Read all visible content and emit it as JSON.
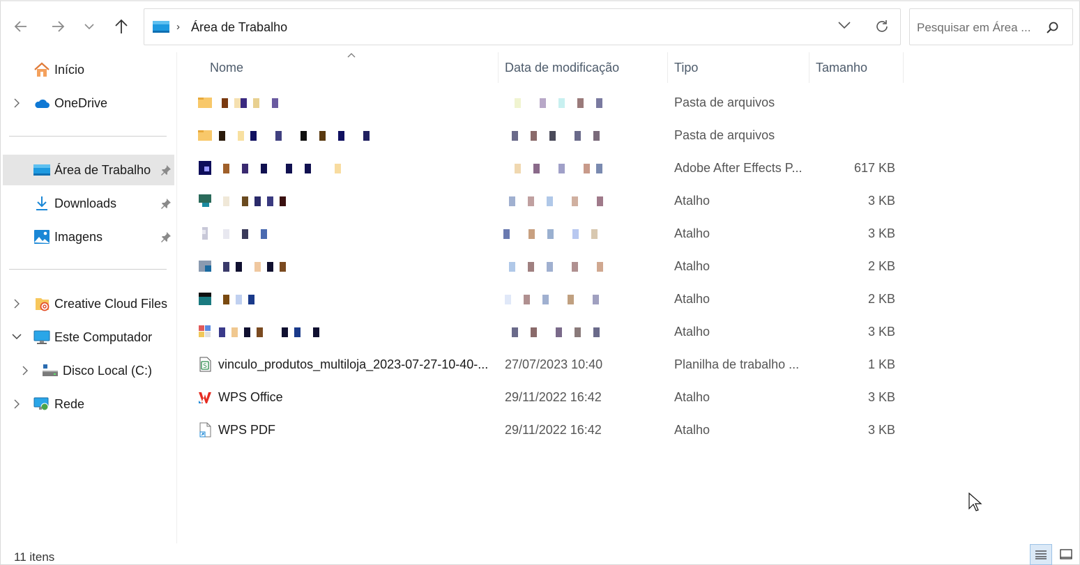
{
  "toolbar": {
    "back": "back-arrow-icon",
    "forward": "forward-arrow-icon",
    "recent": "chevron-down-icon",
    "up": "up-arrow-icon"
  },
  "address": {
    "location": "Área de Trabalho",
    "separator": "›"
  },
  "search": {
    "placeholder": "Pesquisar em Área ..."
  },
  "sidebar": {
    "items": [
      {
        "label": "Início",
        "icon": "home-icon"
      },
      {
        "label": "OneDrive",
        "icon": "cloud-icon"
      },
      {
        "label": "Área de Trabalho",
        "icon": "desktop-icon",
        "selected": true,
        "pinned": true
      },
      {
        "label": "Downloads",
        "icon": "download-icon",
        "pinned": true
      },
      {
        "label": "Imagens",
        "icon": "pictures-icon",
        "pinned": true
      },
      {
        "label": "Creative Cloud Files",
        "icon": "creative-cloud-folder-icon"
      },
      {
        "label": "Este Computador",
        "icon": "computer-icon",
        "expanded": true
      },
      {
        "label": "Disco Local (C:)",
        "icon": "drive-icon"
      },
      {
        "label": "Rede",
        "icon": "network-icon"
      }
    ]
  },
  "columns": {
    "name": "Nome",
    "date": "Data de modificação",
    "type": "Tipo",
    "size": "Tamanho"
  },
  "files": [
    {
      "name": "",
      "date": "",
      "type": "Pasta de arquivos",
      "size": "",
      "obscured": true
    },
    {
      "name": "",
      "date": "",
      "type": "Pasta de arquivos",
      "size": "",
      "obscured": true
    },
    {
      "name": "",
      "date": "",
      "type": "Adobe After Effects P...",
      "size": "617 KB",
      "obscured": true
    },
    {
      "name": "",
      "date": "",
      "type": "Atalho",
      "size": "3 KB",
      "obscured": true
    },
    {
      "name": "",
      "date": "",
      "type": "Atalho",
      "size": "3 KB",
      "obscured": true
    },
    {
      "name": "",
      "date": "",
      "type": "Atalho",
      "size": "2 KB",
      "obscured": true
    },
    {
      "name": "",
      "date": "",
      "type": "Atalho",
      "size": "2 KB",
      "obscured": true
    },
    {
      "name": "",
      "date": "",
      "type": "Atalho",
      "size": "3 KB",
      "obscured": true
    },
    {
      "name": "vinculo_produtos_multiloja_2023-07-27-10-40-...",
      "date": "27/07/2023 10:40",
      "type": "Planilha de trabalho ...",
      "size": "1 KB"
    },
    {
      "name": "WPS Office",
      "date": "29/11/2022 16:42",
      "type": "Atalho",
      "size": "3 KB"
    },
    {
      "name": "WPS PDF",
      "date": "29/11/2022 16:42",
      "type": "Atalho",
      "size": "3 KB"
    }
  ],
  "status": {
    "count": "11 itens"
  },
  "colors": {
    "selected_bg": "#e5e5e5",
    "accent": "#0078d4",
    "header_text": "#4d5b6b"
  }
}
